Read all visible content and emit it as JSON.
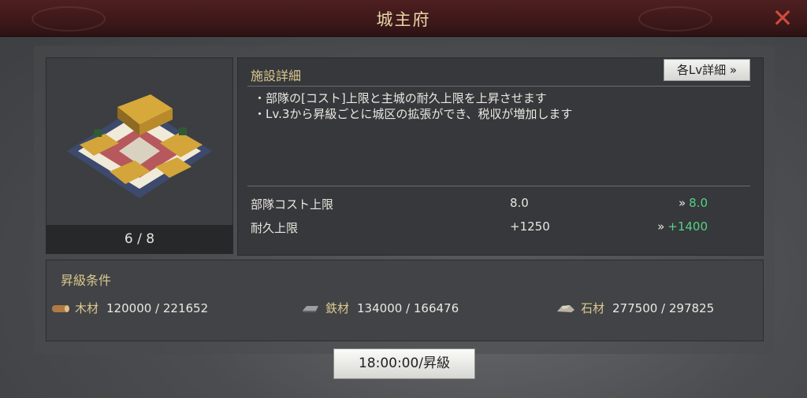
{
  "header": {
    "title": "城主府"
  },
  "building": {
    "level": "6 / 8"
  },
  "details": {
    "title": "施設詳細",
    "lv_button": "各Lv詳細 »",
    "descriptions": [
      "・部隊の[コスト]上限と主城の耐久上限を上昇させます",
      "・Lv.3から昇級ごとに城区の拡張ができ、税収が増加します"
    ],
    "stats": [
      {
        "label": "部隊コスト上限",
        "current": "8.0",
        "next": "8.0"
      },
      {
        "label": "耐久上限",
        "current": "+1250",
        "next": "+1400"
      }
    ],
    "arrow": "»"
  },
  "conditions": {
    "title": "昇級条件",
    "resources": [
      {
        "name": "木材",
        "value": "120000 / 221652",
        "icon": "wood-log-icon"
      },
      {
        "name": "鉄材",
        "value": "134000 / 166476",
        "icon": "iron-ingot-icon"
      },
      {
        "name": "石材",
        "value": "277500 / 297825",
        "icon": "stone-icon"
      }
    ]
  },
  "upgrade_button": "18:00:00/昇級",
  "colors": {
    "accent_gold": "#dcc98f",
    "increase_green": "#55d285",
    "close_red": "#d24a3e"
  }
}
